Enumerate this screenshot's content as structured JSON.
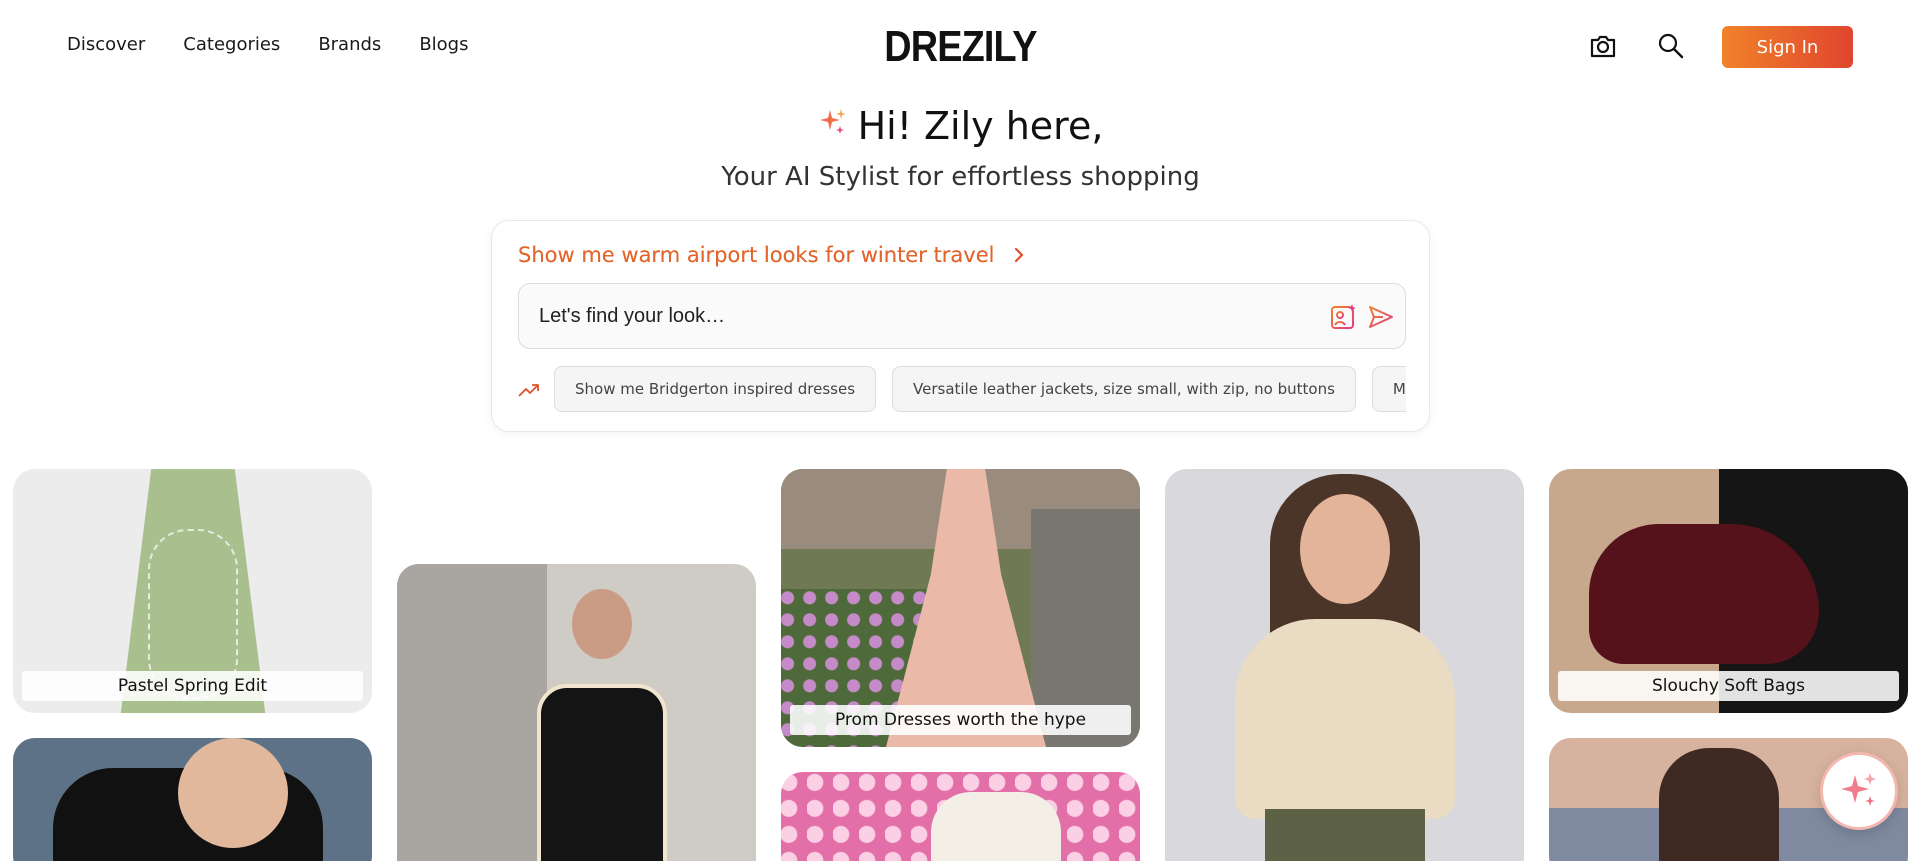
{
  "header": {
    "nav": [
      "Discover",
      "Categories",
      "Brands",
      "Blogs"
    ],
    "logo": "DREZILY",
    "sign_in": "Sign In"
  },
  "hero": {
    "title": "Hi! Zily here,",
    "subtitle": "Your AI Stylist for effortless shopping"
  },
  "search": {
    "suggested_prompt": "Show me warm airport looks for winter travel",
    "placeholder": "Let's find your look…",
    "trending_chips": [
      "Show me Bridgerton inspired dresses",
      "Versatile leather jackets, size small, with zip, no buttons",
      "Midi Satin"
    ]
  },
  "tiles": [
    {
      "label": "Pastel Spring Edit"
    },
    {
      "label": "Prom Dresses worth the hype"
    },
    {
      "label": "Slouchy Soft Bags"
    }
  ],
  "colors": {
    "accent_start": "#f0822a",
    "accent_end": "#e0452e"
  },
  "icons": {
    "camera": "camera-icon",
    "search": "search-icon",
    "sparkle": "sparkle-icon",
    "trending": "trending-icon",
    "image_search": "image-search-icon",
    "send": "send-icon"
  }
}
